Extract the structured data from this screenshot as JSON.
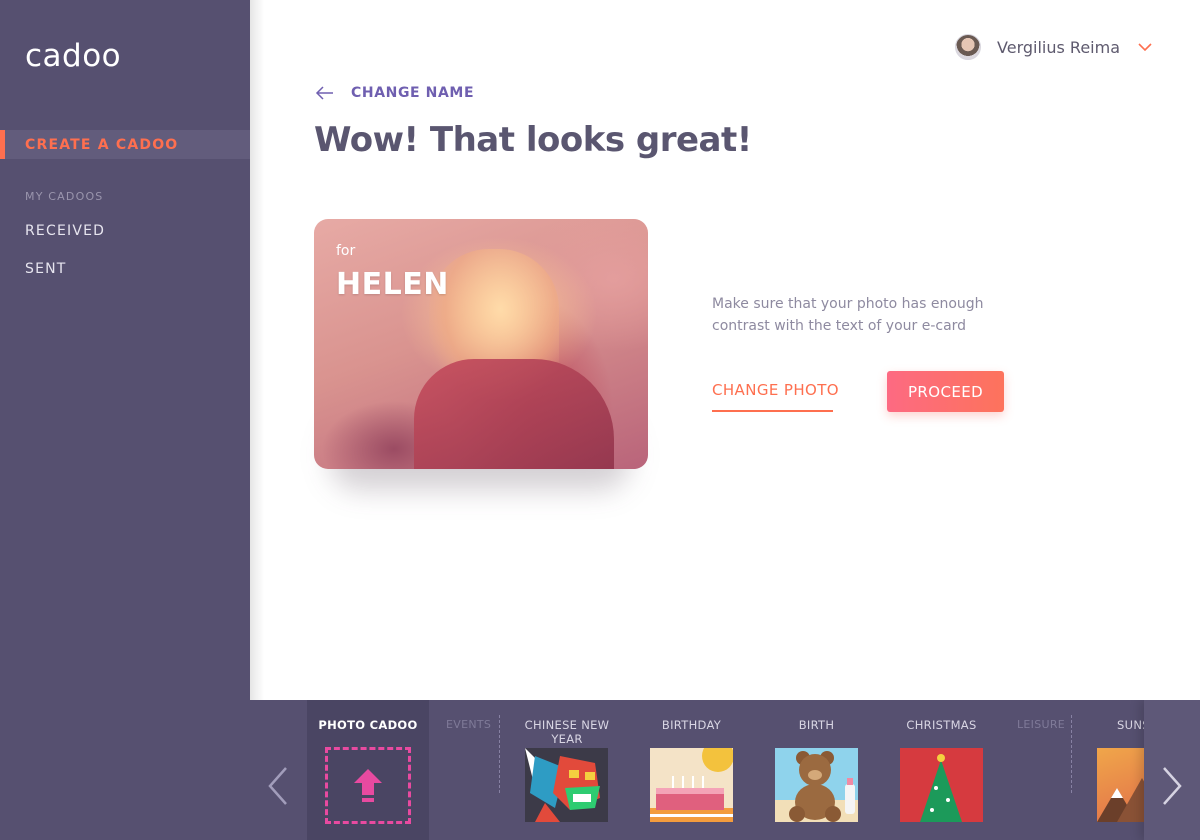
{
  "app": {
    "logo_text": "cadoo"
  },
  "sidebar": {
    "active_item": "CREATE A CADOO",
    "section_label": "MY CADOOS",
    "items": [
      {
        "label": "RECEIVED"
      },
      {
        "label": "SENT"
      }
    ]
  },
  "user": {
    "name": "Vergilius Reima"
  },
  "main": {
    "back_label": "CHANGE NAME",
    "title": "Wow! That looks great!",
    "card": {
      "for_label": "for",
      "recipient": "HELEN"
    },
    "hint": "Make sure that your photo has enough contrast with the text of your e-card",
    "change_photo_label": "CHANGE PHOTO",
    "proceed_label": "PROCEED"
  },
  "categories": {
    "photo_cadoo_label": "PHOTO CADOO",
    "sections": {
      "events": "EVENTS",
      "leisure": "LEISURE"
    },
    "items": [
      {
        "label": "CHINESE NEW YEAR"
      },
      {
        "label": "BIRTHDAY"
      },
      {
        "label": "BIRTH"
      },
      {
        "label": "CHRISTMAS"
      },
      {
        "label": "SUNS"
      }
    ]
  },
  "colors": {
    "accent": "#fe6f4f",
    "sidebar": "#565070",
    "link_purple": "#6f5fb0",
    "upload_dash": "#e84aa0"
  }
}
